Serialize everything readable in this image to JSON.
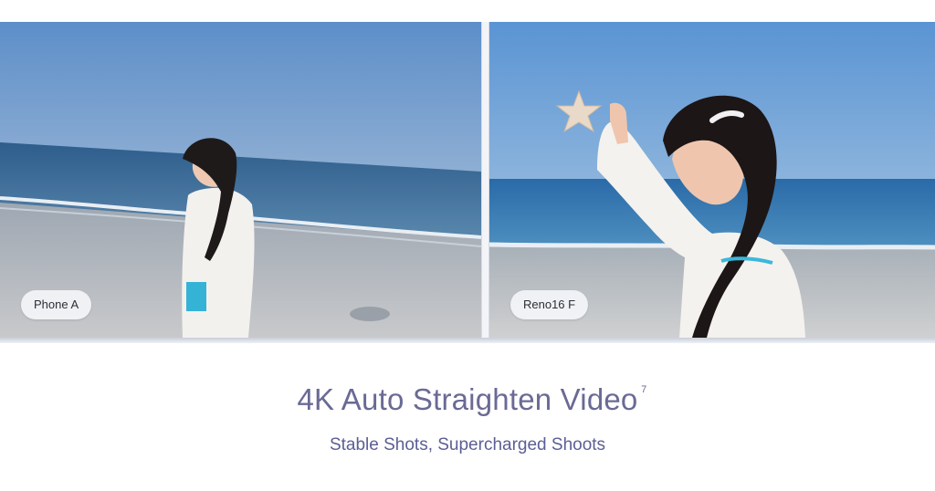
{
  "comparison": {
    "left_label": "Phone A",
    "right_label": "Reno16 F"
  },
  "feature": {
    "title": "4K Auto Straighten Video",
    "footnote": "7",
    "subtitle": "Stable Shots, Supercharged Shoots"
  },
  "colors": {
    "title": "#6a6a95",
    "subtitle": "#5c5e95",
    "label_bg": "#f4f5f8"
  },
  "icons": {
    "left_scene": "beach-tilted-photo",
    "right_scene": "beach-starfish-photo"
  }
}
